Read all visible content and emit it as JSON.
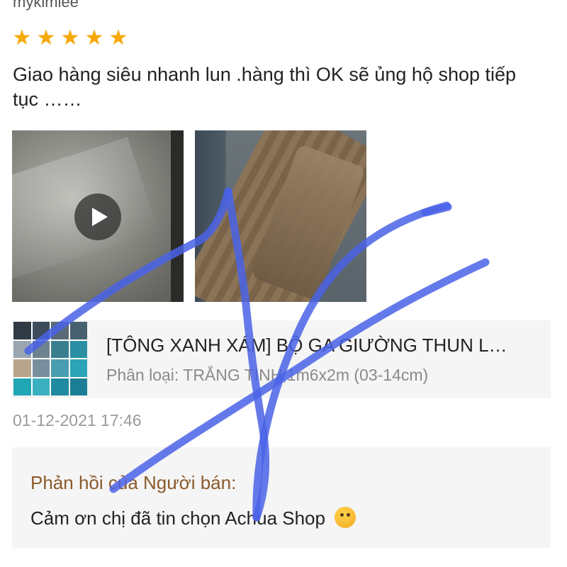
{
  "review": {
    "username": "mykimlee",
    "rating": 5,
    "stars": [
      "★",
      "★",
      "★",
      "★",
      "★"
    ],
    "text": "Giao hàng siêu nhanh lun .hàng thì OK sẽ ủng hộ shop tiếp tục ……"
  },
  "media": {
    "video_icon": "play-icon",
    "photo_icon": "product-photo"
  },
  "product": {
    "name": "[TÔNG XANH XÁM] BỘ GA GIƯỜNG THUN L…",
    "variation": "Phân loại: TRẮNG TINH,1m6x2m (03-14cm)",
    "thumb_colors": [
      "#2f3a44",
      "#3c4c5a",
      "#5b6a78",
      "#486171",
      "#9aa6b0",
      "#6e8391",
      "#3a7f8f",
      "#2b8fa3",
      "#b7a48a",
      "#7a8f9d",
      "#4a9db0",
      "#2da3b8",
      "#20a6b5",
      "#3bb0c0",
      "#1f8aa0",
      "#1b7e95"
    ]
  },
  "timestamp": "01-12-2021 17:46",
  "seller_reply": {
    "label": "Phản hồi của Người bán:",
    "text": "Cảm ơn chị đã tin chọn Achua Shop",
    "emoji": "smiling-face-with-hearts-icon"
  },
  "colors": {
    "star": "#f6a700",
    "reply_label": "#8b5a2b",
    "scribble": "#4a63e6"
  }
}
